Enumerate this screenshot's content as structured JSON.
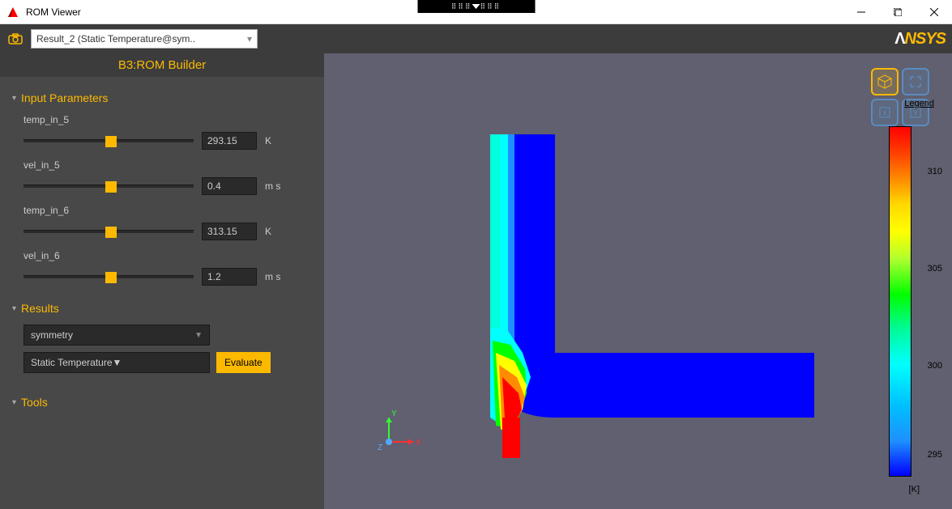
{
  "window": {
    "title": "ROM Viewer"
  },
  "toolbar": {
    "result_select": "Result_2 (Static Temperature@sym..",
    "brand": "ANSYS"
  },
  "sidebar": {
    "title": "B3:ROM Builder",
    "sections": {
      "input_parameters": "Input Parameters",
      "results": "Results",
      "tools": "Tools"
    },
    "params": [
      {
        "label": "temp_in_5",
        "value": "293.15",
        "unit": "K"
      },
      {
        "label": "vel_in_5",
        "value": "0.4",
        "unit": "m s"
      },
      {
        "label": "temp_in_6",
        "value": "313.15",
        "unit": "K"
      },
      {
        "label": "vel_in_6",
        "value": "1.2",
        "unit": "m s"
      }
    ],
    "results": {
      "region": "symmetry",
      "variable": "Static Temperature",
      "evaluate": "Evaluate"
    }
  },
  "viewport": {
    "legend_label": "Legend",
    "legend_unit": "[K]",
    "ticks": [
      "310",
      "305",
      "300",
      "295"
    ],
    "triad": {
      "x": "X",
      "y": "Y",
      "z": "Z"
    }
  }
}
